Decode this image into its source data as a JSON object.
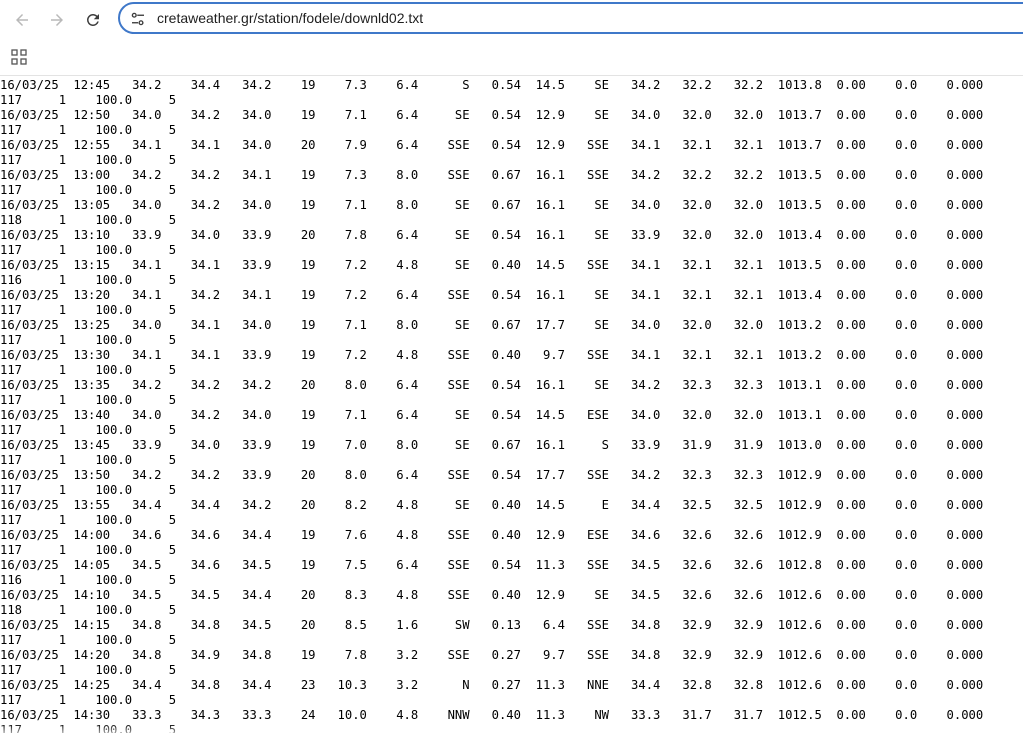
{
  "browser": {
    "url": "cretaweather.gr/station/fodele/downld02.txt",
    "icons": {
      "back": "arrow-left-icon",
      "forward": "arrow-right-icon",
      "reload": "reload-icon",
      "site_info": "tune-icon",
      "apps": "apps-grid-icon"
    }
  },
  "file": {
    "lines": [
      "117     1    100.0     5",
      "16/03/25  12:45   34.2    34.4   34.2    19    7.3    6.4      S   0.54  14.5    SE   34.2   32.2   32.2  1013.8  0.00    0.0    0.000",
      "117     1    100.0     5",
      "16/03/25  12:50   34.0    34.2   34.0    19    7.1    6.4     SE   0.54  12.9    SE   34.0   32.0   32.0  1013.7  0.00    0.0    0.000",
      "117     1    100.0     5",
      "16/03/25  12:55   34.1    34.1   34.0    20    7.9    6.4    SSE   0.54  12.9   SSE   34.1   32.1   32.1  1013.7  0.00    0.0    0.000",
      "117     1    100.0     5",
      "16/03/25  13:00   34.2    34.2   34.1    19    7.3    8.0    SSE   0.67  16.1   SSE   34.2   32.2   32.2  1013.5  0.00    0.0    0.000",
      "117     1    100.0     5",
      "16/03/25  13:05   34.0    34.2   34.0    19    7.1    8.0     SE   0.67  16.1    SE   34.0   32.0   32.0  1013.5  0.00    0.0    0.000",
      "118     1    100.0     5",
      "16/03/25  13:10   33.9    34.0   33.9    20    7.8    6.4     SE   0.54  16.1    SE   33.9   32.0   32.0  1013.4  0.00    0.0    0.000",
      "117     1    100.0     5",
      "16/03/25  13:15   34.1    34.1   33.9    19    7.2    4.8     SE   0.40  14.5   SSE   34.1   32.1   32.1  1013.5  0.00    0.0    0.000",
      "116     1    100.0     5",
      "16/03/25  13:20   34.1    34.2   34.1    19    7.2    6.4    SSE   0.54  16.1    SE   34.1   32.1   32.1  1013.4  0.00    0.0    0.000",
      "117     1    100.0     5",
      "16/03/25  13:25   34.0    34.1   34.0    19    7.1    8.0     SE   0.67  17.7    SE   34.0   32.0   32.0  1013.2  0.00    0.0    0.000",
      "117     1    100.0     5",
      "16/03/25  13:30   34.1    34.1   33.9    19    7.2    4.8    SSE   0.40   9.7   SSE   34.1   32.1   32.1  1013.2  0.00    0.0    0.000",
      "117     1    100.0     5",
      "16/03/25  13:35   34.2    34.2   34.2    20    8.0    6.4    SSE   0.54  16.1    SE   34.2   32.3   32.3  1013.1  0.00    0.0    0.000",
      "117     1    100.0     5",
      "16/03/25  13:40   34.0    34.2   34.0    19    7.1    6.4     SE   0.54  14.5   ESE   34.0   32.0   32.0  1013.1  0.00    0.0    0.000",
      "117     1    100.0     5",
      "16/03/25  13:45   33.9    34.0   33.9    19    7.0    8.0     SE   0.67  16.1     S   33.9   31.9   31.9  1013.0  0.00    0.0    0.000",
      "117     1    100.0     5",
      "16/03/25  13:50   34.2    34.2   33.9    20    8.0    6.4    SSE   0.54  17.7   SSE   34.2   32.3   32.3  1012.9  0.00    0.0    0.000",
      "117     1    100.0     5",
      "16/03/25  13:55   34.4    34.4   34.2    20    8.2    4.8     SE   0.40  14.5     E   34.4   32.5   32.5  1012.9  0.00    0.0    0.000",
      "117     1    100.0     5",
      "16/03/25  14:00   34.6    34.6   34.4    19    7.6    4.8    SSE   0.40  12.9   ESE   34.6   32.6   32.6  1012.9  0.00    0.0    0.000",
      "117     1    100.0     5",
      "16/03/25  14:05   34.5    34.6   34.5    19    7.5    6.4    SSE   0.54  11.3   SSE   34.5   32.6   32.6  1012.8  0.00    0.0    0.000",
      "116     1    100.0     5",
      "16/03/25  14:10   34.5    34.5   34.4    20    8.3    4.8    SSE   0.40  12.9    SE   34.5   32.6   32.6  1012.6  0.00    0.0    0.000",
      "118     1    100.0     5",
      "16/03/25  14:15   34.8    34.8   34.5    20    8.5    1.6     SW   0.13   6.4   SSE   34.8   32.9   32.9  1012.6  0.00    0.0    0.000",
      "117     1    100.0     5",
      "16/03/25  14:20   34.8    34.9   34.8    19    7.8    3.2    SSE   0.27   9.7   SSE   34.8   32.9   32.9  1012.6  0.00    0.0    0.000",
      "117     1    100.0     5",
      "16/03/25  14:25   34.4    34.8   34.4    23   10.3    3.2      N   0.27  11.3   NNE   34.4   32.8   32.8  1012.6  0.00    0.0    0.000",
      "117     1    100.0     5",
      "16/03/25  14:30   33.3    34.3   33.3    24   10.0    4.8    NNW   0.40  11.3    NW   33.3   31.7   31.7  1012.5  0.00    0.0    0.000",
      "117     1    100.0     5"
    ]
  }
}
